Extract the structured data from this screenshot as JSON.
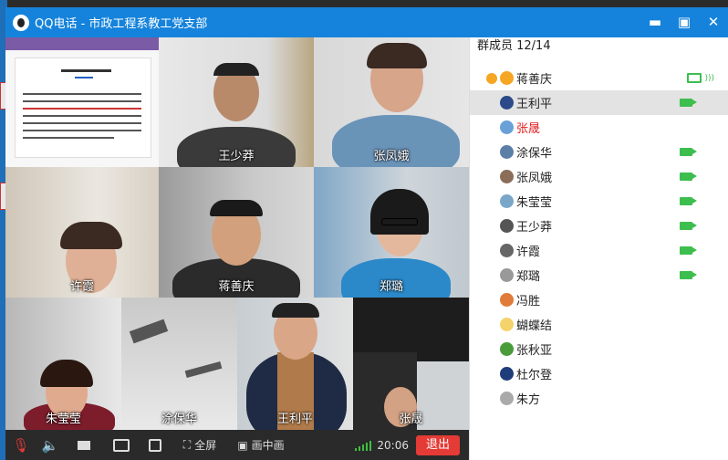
{
  "window": {
    "title": "QQ电话 - 市政工程系教工党支部",
    "controls": {
      "minimize": "▬",
      "maximize": "▣",
      "close": "✕"
    }
  },
  "video_tiles": [
    {
      "name": "",
      "kind": "screen-share"
    },
    {
      "name": "王少莽"
    },
    {
      "name": "张凤娥"
    },
    {
      "name": "许霞"
    },
    {
      "name": "蒋善庆"
    },
    {
      "name": "郑璐"
    },
    {
      "name": "朱莹莹"
    },
    {
      "name": "涂保华"
    },
    {
      "name": "王利平"
    },
    {
      "name": "张晟"
    }
  ],
  "control_bar": {
    "mic_icon": "mic-muted-icon",
    "fullscreen_label": "全屏",
    "pip_label": "画中画",
    "time": "20:06",
    "hangup_label": "退出"
  },
  "sidebar": {
    "header": "群成员 12/14",
    "members": [
      {
        "name": "蒋善庆",
        "owner": true,
        "status": "screen-share",
        "avatar_color": "#f5a623",
        "name_color": "#222222",
        "selected": false
      },
      {
        "name": "王利平",
        "status": "camera",
        "avatar_color": "#2c4a8a",
        "name_color": "#222222",
        "selected": true
      },
      {
        "name": "张晟",
        "status": "none",
        "avatar_color": "#6aa0d8",
        "name_color": "#e02020",
        "selected": false
      },
      {
        "name": "涂保华",
        "status": "camera",
        "avatar_color": "#5b7fa6",
        "name_color": "#222222",
        "selected": false
      },
      {
        "name": "张凤娥",
        "status": "camera",
        "avatar_color": "#8a6e5a",
        "name_color": "#222222",
        "selected": false
      },
      {
        "name": "朱莹莹",
        "status": "camera",
        "avatar_color": "#7aa7c9",
        "name_color": "#222222",
        "selected": false
      },
      {
        "name": "王少莽",
        "status": "camera",
        "avatar_color": "#555555",
        "name_color": "#222222",
        "selected": false
      },
      {
        "name": "许霞",
        "status": "camera",
        "avatar_color": "#666666",
        "name_color": "#222222",
        "selected": false
      },
      {
        "name": "郑璐",
        "status": "camera",
        "avatar_color": "#999999",
        "name_color": "#222222",
        "selected": false
      },
      {
        "name": "冯胜",
        "status": "none",
        "avatar_color": "#e07b39",
        "name_color": "#222222",
        "selected": false
      },
      {
        "name": "蝴蝶结",
        "status": "none",
        "avatar_color": "#f3d36a",
        "name_color": "#222222",
        "selected": false
      },
      {
        "name": "张秋亚",
        "status": "none",
        "avatar_color": "#4a9c3a",
        "name_color": "#222222",
        "selected": false
      },
      {
        "name": "杜尔登",
        "status": "none",
        "avatar_color": "#1e3d7a",
        "name_color": "#222222",
        "selected": false
      },
      {
        "name": "朱方",
        "status": "none",
        "avatar_color": "#aaaaaa",
        "name_color": "#222222",
        "selected": false
      }
    ]
  },
  "colors": {
    "titlebar": "#1583db",
    "active_indicator": "#3dbe4e",
    "hangup": "#e53b36"
  }
}
